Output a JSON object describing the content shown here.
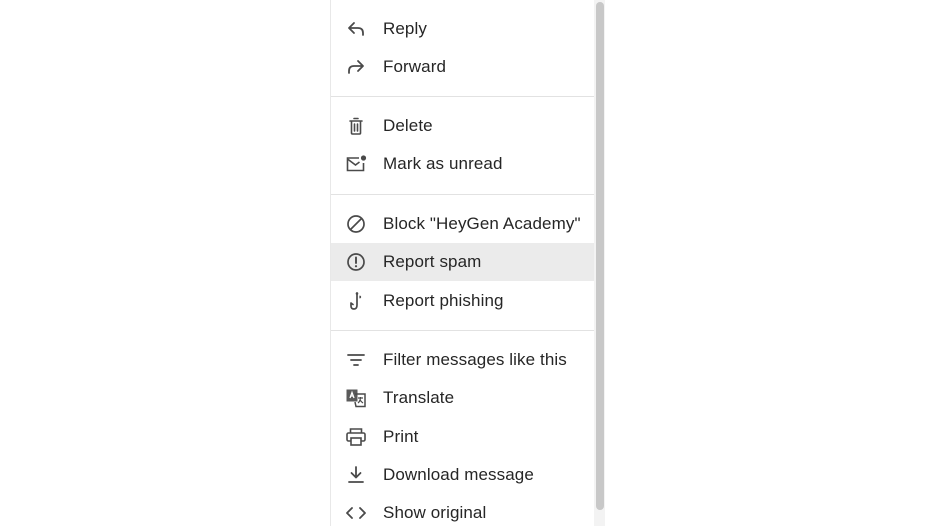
{
  "menu": {
    "items": [
      {
        "label": "Reply",
        "icon": "reply-icon"
      },
      {
        "label": "Forward",
        "icon": "forward-icon"
      },
      {
        "label": "Delete",
        "icon": "trash-icon"
      },
      {
        "label": "Mark as unread",
        "icon": "mark-unread-icon"
      },
      {
        "label": "Block \"HeyGen Academy\"",
        "icon": "block-icon"
      },
      {
        "label": "Report spam",
        "icon": "report-spam-icon",
        "highlighted": true
      },
      {
        "label": "Report phishing",
        "icon": "phishing-hook-icon"
      },
      {
        "label": "Filter messages like this",
        "icon": "filter-icon"
      },
      {
        "label": "Translate",
        "icon": "translate-icon"
      },
      {
        "label": "Print",
        "icon": "print-icon"
      },
      {
        "label": "Download message",
        "icon": "download-icon"
      },
      {
        "label": "Show original",
        "icon": "code-icon"
      }
    ]
  },
  "colors": {
    "text": "#262626",
    "icon": "#4a4a4a",
    "highlight": "#ebebeb",
    "divider": "#e2e2e2",
    "scrollbar_thumb": "#c8c8c8"
  }
}
